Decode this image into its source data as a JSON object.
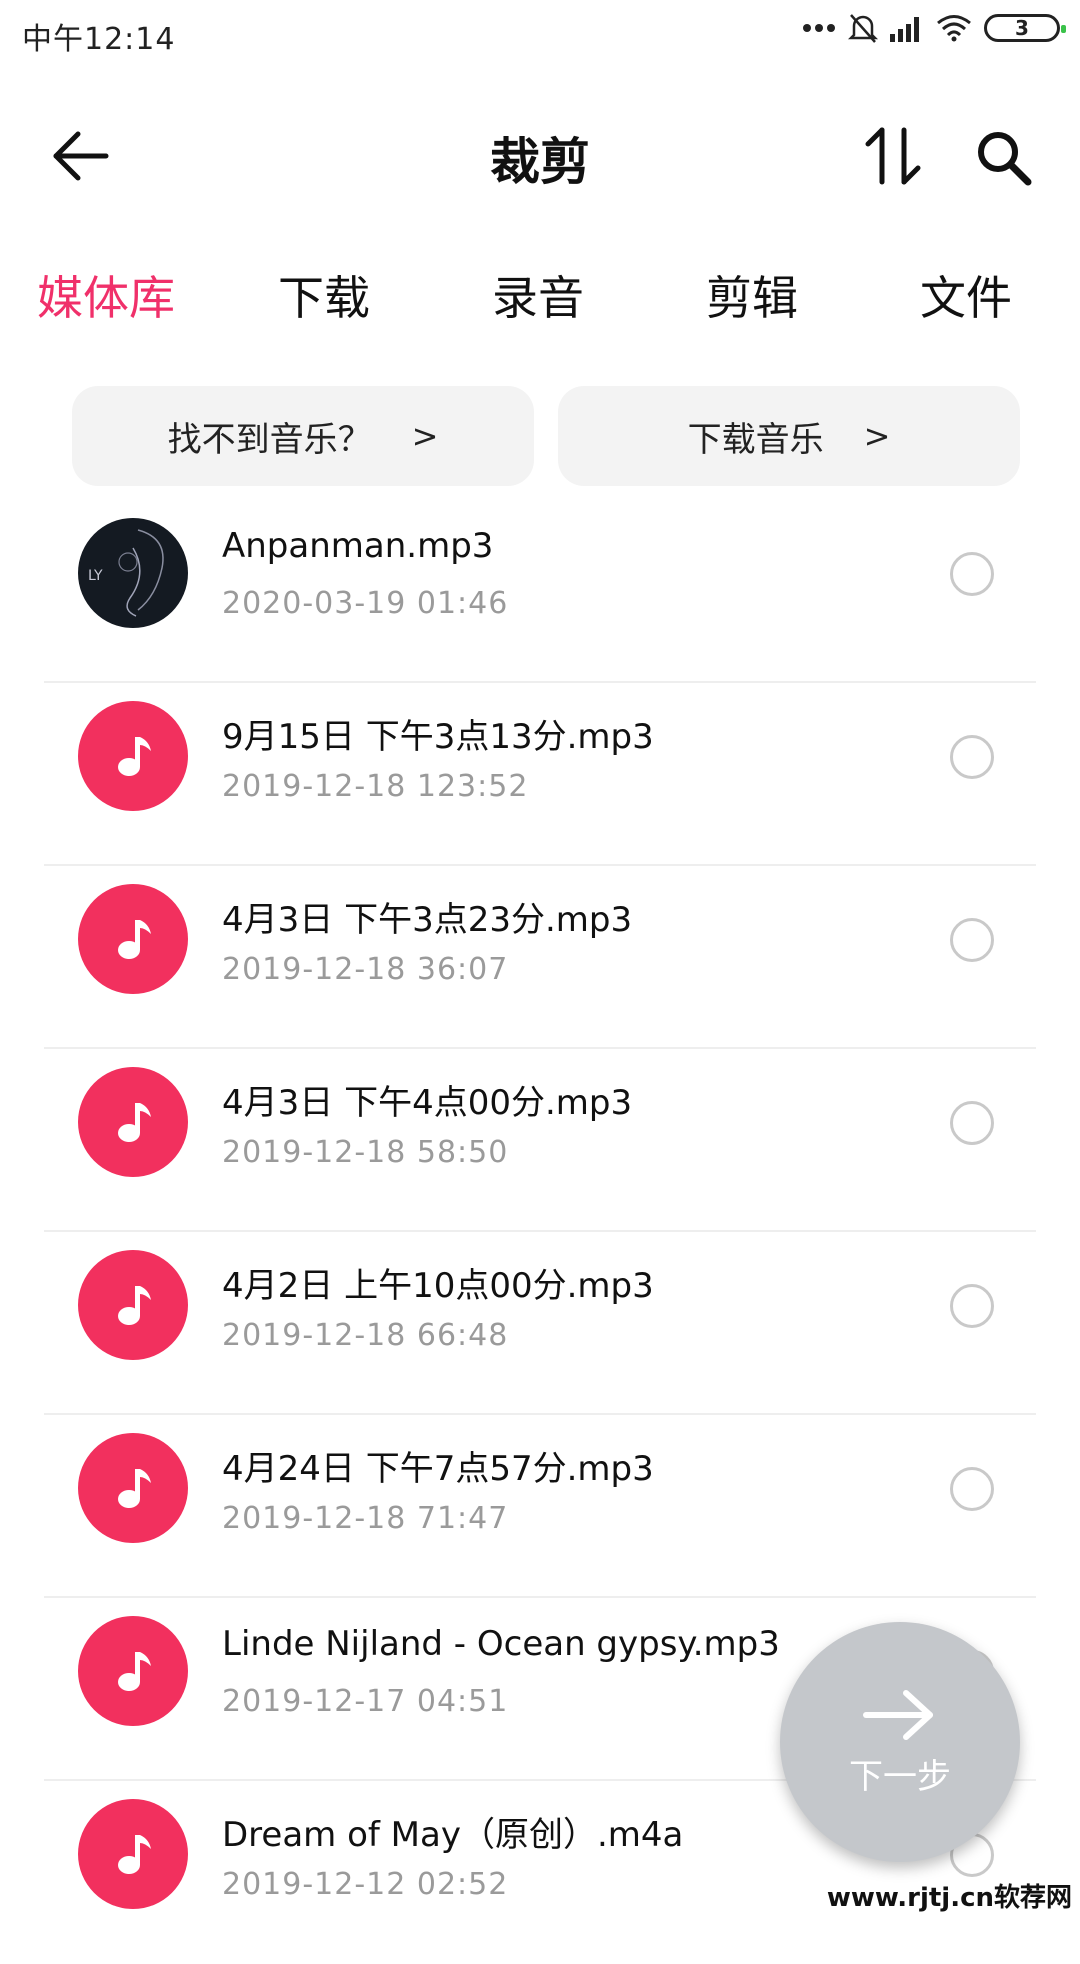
{
  "status_bar": {
    "time": "中午12:14",
    "battery": "3",
    "icons": [
      "more-dots-icon",
      "mute-bell-icon",
      "signal-icon",
      "wifi-icon",
      "battery-icon"
    ]
  },
  "header": {
    "title": "裁剪",
    "icons": [
      "back-arrow-icon",
      "sort-icon",
      "search-icon"
    ]
  },
  "tabs": [
    {
      "label": "媒体库",
      "active": true
    },
    {
      "label": "下载",
      "active": false
    },
    {
      "label": "录音",
      "active": false
    },
    {
      "label": "剪辑",
      "active": false
    },
    {
      "label": "文件",
      "active": false
    }
  ],
  "quick_buttons": [
    {
      "label": "找不到音乐？",
      "chevron": ">"
    },
    {
      "label": "下载音乐",
      "chevron": ">"
    }
  ],
  "files": [
    {
      "name": "Anpanman.mp3",
      "meta": "2020-03-19 01:46",
      "thumb": "cover",
      "cover_text": "LY"
    },
    {
      "name": "9月15日 下午3点13分.mp3",
      "meta": "2019-12-18 123:52",
      "thumb": "music-note-icon"
    },
    {
      "name": "4月3日 下午3点23分.mp3",
      "meta": "2019-12-18 36:07",
      "thumb": "music-note-icon"
    },
    {
      "name": "4月3日 下午4点00分.mp3",
      "meta": "2019-12-18 58:50",
      "thumb": "music-note-icon"
    },
    {
      "name": "4月2日 上午10点00分.mp3",
      "meta": "2019-12-18 66:48",
      "thumb": "music-note-icon"
    },
    {
      "name": "4月24日 下午7点57分.mp3",
      "meta": "2019-12-18 71:47",
      "thumb": "music-note-icon"
    },
    {
      "name": "Linde Nijland - Ocean gypsy.mp3",
      "meta": "2019-12-17 04:51",
      "thumb": "music-note-icon"
    },
    {
      "name": "Dream of May（原创）.m4a",
      "meta": "2019-12-12 02:52",
      "thumb": "music-note-icon"
    }
  ],
  "fab": {
    "label": "下一步",
    "icon": "arrow-right-icon"
  },
  "watermark": "www.rjtj.cn软荐网",
  "colors": {
    "accent": "#f0306a",
    "note_bg": "#f2305e",
    "fab_bg": "#c4c7cb"
  }
}
